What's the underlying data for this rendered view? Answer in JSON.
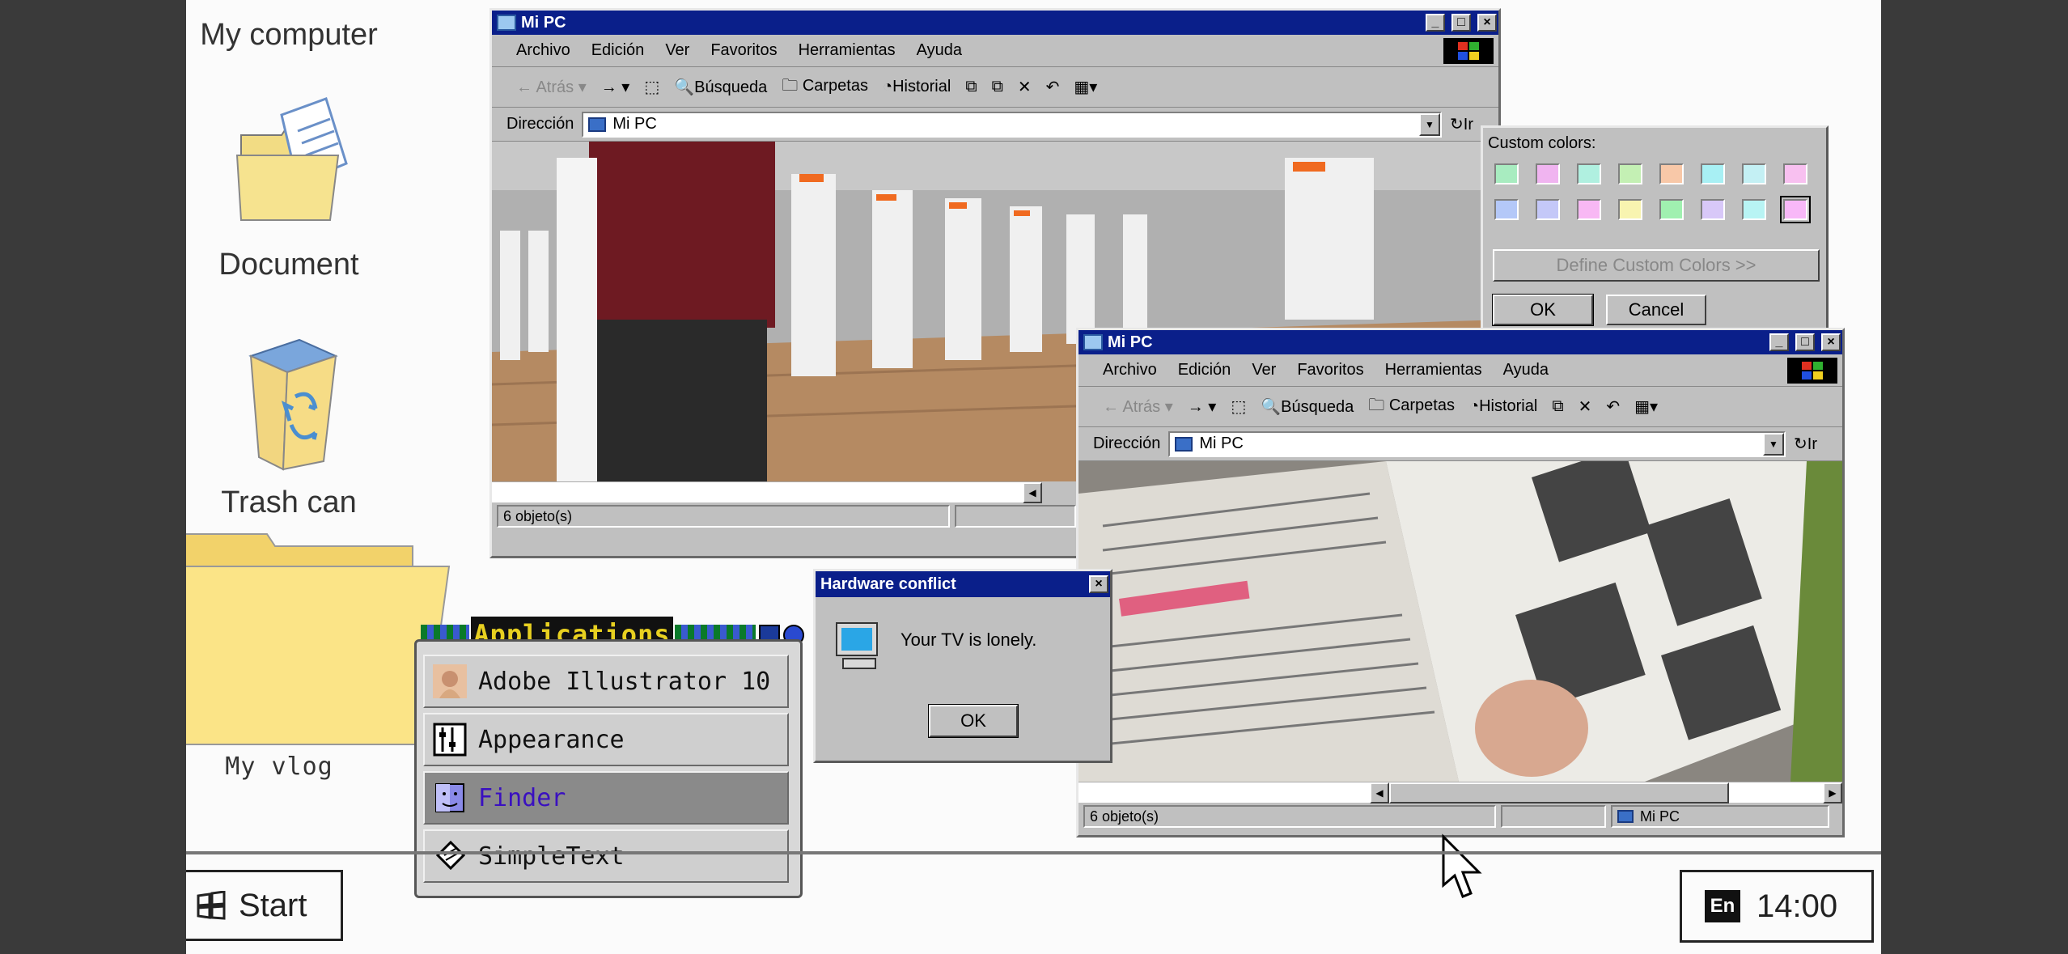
{
  "desktop": {
    "icons": [
      {
        "label": "My computer"
      },
      {
        "label": "Document"
      },
      {
        "label": "Trash can"
      },
      {
        "label": "My vlog"
      }
    ]
  },
  "window1": {
    "title": "Mi PC",
    "menu": [
      "Archivo",
      "Edición",
      "Ver",
      "Favoritos",
      "Herramientas",
      "Ayuda"
    ],
    "toolbar": {
      "back": "Atrás",
      "search": "Búsqueda",
      "folders": "Carpetas",
      "history": "Historial"
    },
    "address_label": "Dirección",
    "address_value": "Mi PC",
    "go": "Ir",
    "status": "6 objeto(s)"
  },
  "window2": {
    "title": "Mi PC",
    "menu": [
      "Archivo",
      "Edición",
      "Ver",
      "Favoritos",
      "Herramientas",
      "Ayuda"
    ],
    "toolbar": {
      "back": "Atrás",
      "search": "Búsqueda",
      "folders": "Carpetas",
      "history": "Historial"
    },
    "address_label": "Dirección",
    "address_value": "Mi PC",
    "go": "Ir",
    "status": "6 objeto(s)",
    "status_right": "Mi PC"
  },
  "color_dialog": {
    "label": "Custom colors:",
    "swatches": [
      "#a8ecc0",
      "#f0b4f0",
      "#b0f0e0",
      "#c4f0b4",
      "#f8c8a8",
      "#a8f0f4",
      "#c4f0f4",
      "#f8c0f0",
      "#b4c8f8",
      "#c4c8f8",
      "#f8b8f4",
      "#f8f4b0",
      "#a0f0b0",
      "#d8c8f8",
      "#b8f4f4",
      "#f8b8f8"
    ],
    "define_button": "Define Custom Colors >>",
    "ok": "OK",
    "cancel": "Cancel"
  },
  "hw_dialog": {
    "title": "Hardware conflict",
    "message": "Your TV is lonely.",
    "ok": "OK"
  },
  "apps_menu": {
    "title": "Applications",
    "items": [
      "Adobe Illustrator 10",
      "Appearance",
      "Finder",
      "SimpleText"
    ],
    "selected": "Finder"
  },
  "taskbar": {
    "start": "Start",
    "lang": "En",
    "time": "14:00"
  }
}
